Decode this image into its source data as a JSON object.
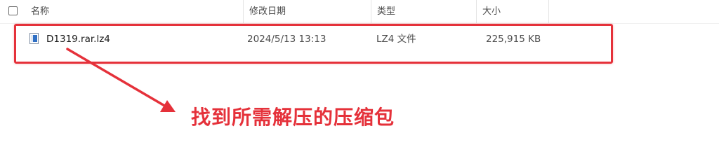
{
  "header": {
    "name_label": "名称",
    "date_label": "修改日期",
    "type_label": "类型",
    "size_label": "大小",
    "sort_indicator": "^"
  },
  "files": [
    {
      "name": "D1319.rar.lz4",
      "modified": "2024/5/13 13:13",
      "type": "LZ4 文件",
      "size": "225,915 KB",
      "icon": "file-icon"
    }
  ],
  "annotation": {
    "text": "找到所需解压的压缩包",
    "color": "#e5313a"
  }
}
